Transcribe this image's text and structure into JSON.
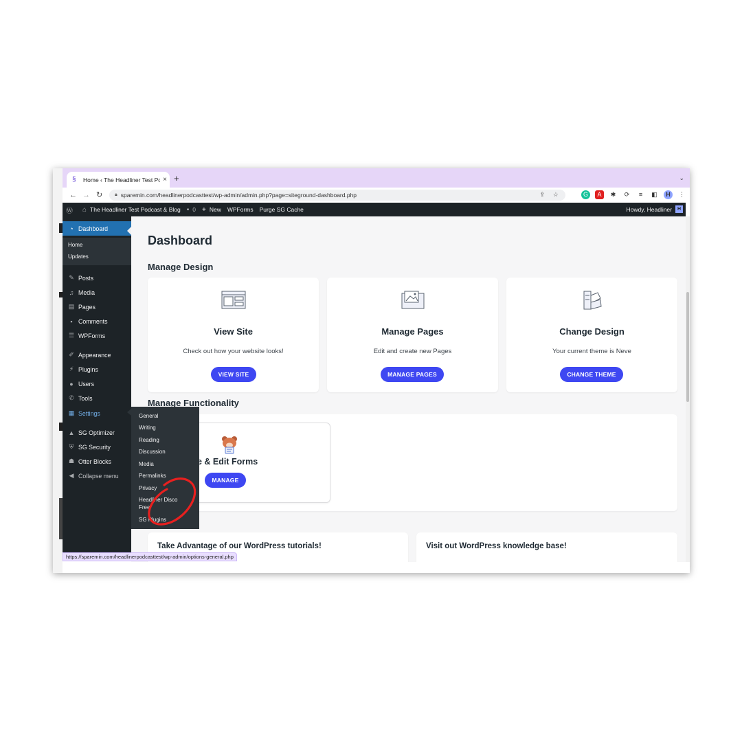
{
  "browser": {
    "tab_title": "Home ‹ The Headliner Test Pod",
    "new_tab": "+",
    "tab_close": "×",
    "url": "sparemin.com/headlinerpodcasttest/wp-admin/admin.php?page=siteground-dashboard.php",
    "status_url": "https://sparemin.com/headlinerpodcasttest/wp-admin/options-general.php"
  },
  "adminbar": {
    "site_name": "The Headliner Test Podcast & Blog",
    "comments_count": "0",
    "new_label": "New",
    "wpforms": "WPForms",
    "purge": "Purge SG Cache",
    "howdy": "Howdy, Headliner"
  },
  "sidebar": {
    "dashboard": "Dashboard",
    "home": "Home",
    "updates": "Updates",
    "posts": "Posts",
    "media": "Media",
    "pages": "Pages",
    "comments": "Comments",
    "wpforms": "WPForms",
    "appearance": "Appearance",
    "plugins": "Plugins",
    "users": "Users",
    "tools": "Tools",
    "settings": "Settings",
    "sg_optimizer": "SG Optimizer",
    "sg_security": "SG Security",
    "otter_blocks": "Otter Blocks",
    "collapse": "Collapse menu"
  },
  "settings_flyout": {
    "general": "General",
    "writing": "Writing",
    "reading": "Reading",
    "discussion": "Discussion",
    "media": "Media",
    "permalinks": "Permalinks",
    "privacy": "Privacy",
    "headliner_line1": "Headliner Disco",
    "headliner_line2": "Free",
    "sg_plugins": "SG Plugins"
  },
  "main": {
    "title": "Dashboard",
    "manage_design": "Manage Design",
    "cards": [
      {
        "title": "View Site",
        "text": "Check out how your website looks!",
        "button": "VIEW SITE"
      },
      {
        "title": "Manage Pages",
        "text": "Edit and create new Pages",
        "button": "MANAGE PAGES"
      },
      {
        "title": "Change Design",
        "text": "Your current theme is Neve",
        "button": "CHANGE THEME"
      }
    ],
    "manage_functionality": "Manage Functionality",
    "forms_card": {
      "title": "e & Edit Forms",
      "button": "MANAGE"
    },
    "tutorials": "Take Advantage of our WordPress tutorials!",
    "knowledge": "Visit out WordPress knowledge base!"
  },
  "colors": {
    "accent_button": "#3e47f2",
    "wp_dark": "#1d2327",
    "wp_blue": "#2271b1",
    "tab_bar": "#e6d6f8",
    "annotation": "#e8201f"
  }
}
